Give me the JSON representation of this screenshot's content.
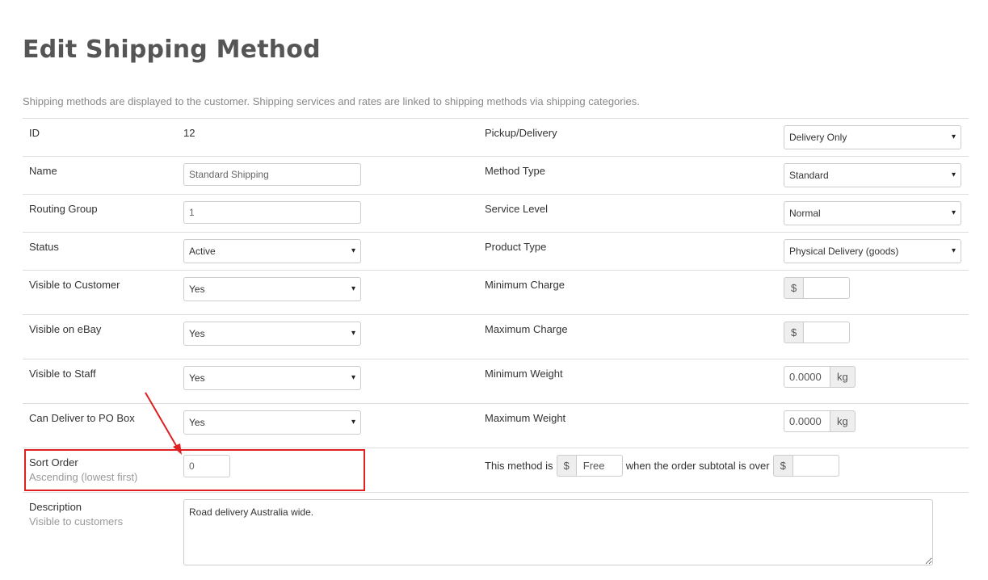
{
  "page": {
    "title": "Edit Shipping Method",
    "intro": "Shipping methods are displayed to the customer. Shipping services and rates are linked to shipping methods via shipping categories."
  },
  "left": {
    "id_label": "ID",
    "id_value": "12",
    "name_label": "Name",
    "name_value": "Standard Shipping",
    "routing_label": "Routing Group",
    "routing_value": "1",
    "status_label": "Status",
    "status_value": "Active",
    "visible_customer_label": "Visible to Customer",
    "visible_customer_value": "Yes",
    "visible_ebay_label": "Visible on eBay",
    "visible_ebay_value": "Yes",
    "visible_staff_label": "Visible to Staff",
    "visible_staff_value": "Yes",
    "po_box_label": "Can Deliver to PO Box",
    "po_box_value": "Yes",
    "sort_label": "Sort Order",
    "sort_sub": "Ascending (lowest first)",
    "sort_value": "0",
    "desc_label": "Description",
    "desc_sub": "Visible to customers",
    "desc_value": "Road delivery Australia wide."
  },
  "right": {
    "pickup_label": "Pickup/Delivery",
    "pickup_value": "Delivery Only",
    "method_type_label": "Method Type",
    "method_type_value": "Standard",
    "service_level_label": "Service Level",
    "service_level_value": "Normal",
    "product_type_label": "Product Type",
    "product_type_value": "Physical Delivery (goods)",
    "min_charge_label": "Minimum Charge",
    "max_charge_label": "Maximum Charge",
    "min_weight_label": "Minimum Weight",
    "min_weight_value": "0.0000",
    "max_weight_label": "Maximum Weight",
    "max_weight_value": "0.0000",
    "free_prefix": "This method is",
    "free_value": "Free",
    "free_middle": "when the order subtotal is over",
    "currency_symbol": "$",
    "weight_unit": "kg"
  },
  "icons": {
    "dropdown": "▾"
  },
  "colors": {
    "annotation_red": "#e02020"
  }
}
